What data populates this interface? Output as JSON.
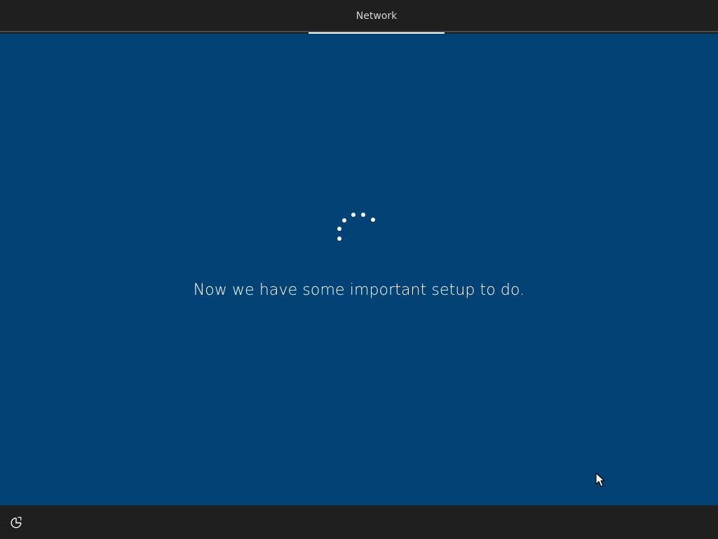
{
  "header": {
    "tabs": [
      {
        "label": "Network",
        "active": true
      }
    ]
  },
  "main": {
    "message": "Now we have some important setup to do.",
    "spinner": "loading-dots-icon",
    "background_color": "#034274"
  },
  "footer": {
    "accessibility_icon": "ease-of-access-icon"
  },
  "colors": {
    "bar_bg": "#1f1f1f",
    "accent": "#ffffff",
    "text": "#ffffff"
  }
}
